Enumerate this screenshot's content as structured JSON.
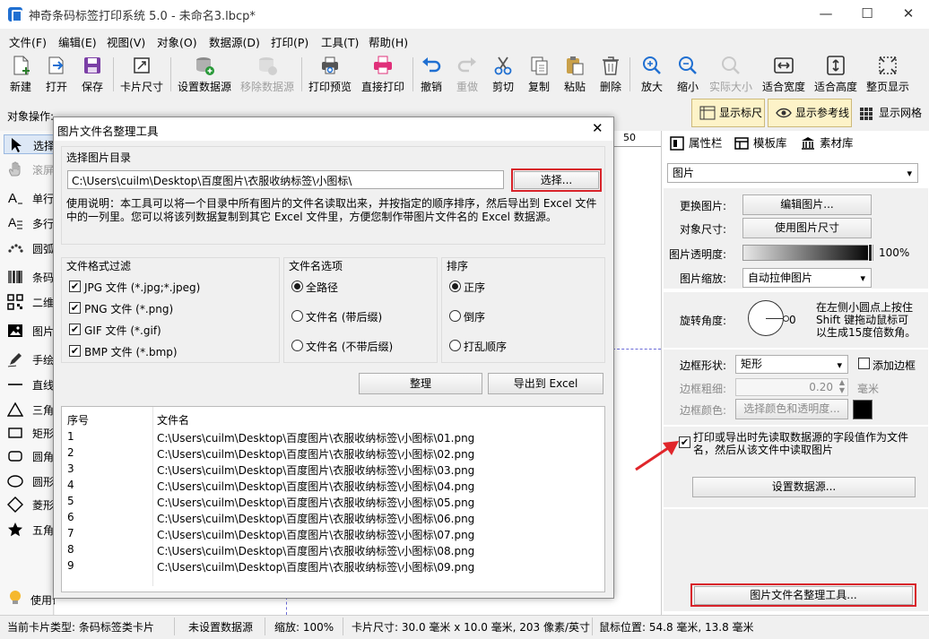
{
  "window": {
    "title": "神奇条码标签打印系统 5.0 - 未命名3.lbcp*",
    "min": "—",
    "max": "☐",
    "close": "✕"
  },
  "menu": [
    "文件(F)",
    "编辑(E)",
    "视图(V)",
    "对象(O)",
    "数据源(D)",
    "打印(P)",
    "工具(T)",
    "帮助(H)"
  ],
  "toolbar": {
    "new": "新建",
    "open": "打开",
    "save": "保存",
    "card_size": "卡片尺寸",
    "set_datasource": "设置数据源",
    "remove_datasource": "移除数据源",
    "print_preview": "打印预览",
    "direct_print": "直接打印",
    "undo": "撤销",
    "redo": "重做",
    "cut": "剪切",
    "copy": "复制",
    "paste": "粘贴",
    "delete": "删除",
    "zoom_in": "放大",
    "zoom_out": "缩小",
    "actual_size": "实际大小",
    "fit_width": "适合宽度",
    "fit_height": "适合高度",
    "full_page": "整页显示"
  },
  "objbar": {
    "label": "对象操作:",
    "show_ruler": "显示标尺",
    "show_guides": "显示参考线",
    "show_grid": "显示网格"
  },
  "left_panel": {
    "items": [
      "选择",
      "滚屏",
      "单行",
      "多行",
      "圆弧",
      "条码",
      "二维",
      "图片",
      "手绘",
      "直线",
      "三角",
      "矩形",
      "圆角",
      "圆形",
      "菱形",
      "五角"
    ],
    "help": "使用说明"
  },
  "ruler": {
    "mark": "50"
  },
  "right_panel": {
    "tabs": [
      "属性栏",
      "模板库",
      "素材库"
    ],
    "object_type": "图片",
    "change_image_label": "更换图片:",
    "edit_image_btn": "编辑图片...",
    "object_size_label": "对象尺寸:",
    "use_image_size_btn": "使用图片尺寸",
    "opacity_label": "图片透明度:",
    "opacity_value": "100%",
    "opacity_level": 1.0,
    "scale_label": "图片缩放:",
    "scale_value": "自动拉伸图片",
    "rotation_label": "旋转角度:",
    "rotation_value": "0",
    "rotation_hint": "在左侧小圆点上按住 Shift 键拖动鼠标可以生成15度倍数角。",
    "border_shape_label": "边框形状:",
    "border_shape_value": "矩形",
    "add_border_label": "添加边框",
    "add_border_checked": false,
    "border_width_label": "边框粗细:",
    "border_width_value": "0.20",
    "border_width_unit": "毫米",
    "border_color_label": "边框颜色:",
    "border_color_btn": "选择颜色和透明度...",
    "border_color_swatch": "#000000",
    "read_from_ds_checked": true,
    "read_from_ds_text": "打印或导出时先读取数据源的字段值作为文件名，然后从该文件中读取图片",
    "set_datasource_btn": "设置数据源...",
    "filename_tool_btn": "图片文件名整理工具..."
  },
  "status": {
    "card_type": "当前卡片类型: 条码标签类卡片",
    "datasource": "未设置数据源",
    "zoom": "缩放: 100%",
    "card_size": "卡片尺寸: 30.0 毫米 x 10.0 毫米, 203 像素/英寸",
    "mouse_pos": "鼠标位置: 54.8 毫米, 13.8 毫米"
  },
  "dialog": {
    "title": "图片文件名整理工具",
    "close": "✕",
    "dir_group": "选择图片目录",
    "dir_path": "C:\\Users\\cuilm\\Desktop\\百度图片\\衣服收纳标签\\小图标\\",
    "choose_btn": "选择...",
    "usage": "使用说明：本工具可以将一个目录中所有图片的文件名读取出来，并按指定的顺序排序，然后导出到 Excel 文件中的一列里。您可以将该列数据复制到其它 Excel 文件里，方便您制作带图片文件名的 Excel 数据源。",
    "filter_group": "文件格式过滤",
    "filters": [
      {
        "label": "JPG 文件 (*.jpg;*.jpeg)",
        "checked": true
      },
      {
        "label": "PNG 文件 (*.png)",
        "checked": true
      },
      {
        "label": "GIF 文件 (*.gif)",
        "checked": true
      },
      {
        "label": "BMP 文件 (*.bmp)",
        "checked": true
      }
    ],
    "name_group": "文件名选项",
    "name_options": [
      {
        "label": "全路径",
        "selected": true
      },
      {
        "label": "文件名 (带后缀)",
        "selected": false
      },
      {
        "label": "文件名 (不带后缀)",
        "selected": false
      }
    ],
    "sort_group": "排序",
    "sort_options": [
      {
        "label": "正序",
        "selected": true
      },
      {
        "label": "倒序",
        "selected": false
      },
      {
        "label": "打乱顺序",
        "selected": false
      }
    ],
    "organize_btn": "整理",
    "export_btn": "导出到 Excel",
    "list_headers": [
      "序号",
      "文件名"
    ],
    "rows": [
      [
        "1",
        "C:\\Users\\cuilm\\Desktop\\百度图片\\衣服收纳标签\\小图标\\01.png"
      ],
      [
        "2",
        "C:\\Users\\cuilm\\Desktop\\百度图片\\衣服收纳标签\\小图标\\02.png"
      ],
      [
        "3",
        "C:\\Users\\cuilm\\Desktop\\百度图片\\衣服收纳标签\\小图标\\03.png"
      ],
      [
        "4",
        "C:\\Users\\cuilm\\Desktop\\百度图片\\衣服收纳标签\\小图标\\04.png"
      ],
      [
        "5",
        "C:\\Users\\cuilm\\Desktop\\百度图片\\衣服收纳标签\\小图标\\05.png"
      ],
      [
        "6",
        "C:\\Users\\cuilm\\Desktop\\百度图片\\衣服收纳标签\\小图标\\06.png"
      ],
      [
        "7",
        "C:\\Users\\cuilm\\Desktop\\百度图片\\衣服收纳标签\\小图标\\07.png"
      ],
      [
        "8",
        "C:\\Users\\cuilm\\Desktop\\百度图片\\衣服收纳标签\\小图标\\08.png"
      ],
      [
        "9",
        "C:\\Users\\cuilm\\Desktop\\百度图片\\衣服收纳标签\\小图标\\09.png"
      ]
    ]
  },
  "colors": {
    "highlight_red": "#d8232a",
    "arrow_red": "#e0262b",
    "accent_blue": "#1f6fd1"
  }
}
